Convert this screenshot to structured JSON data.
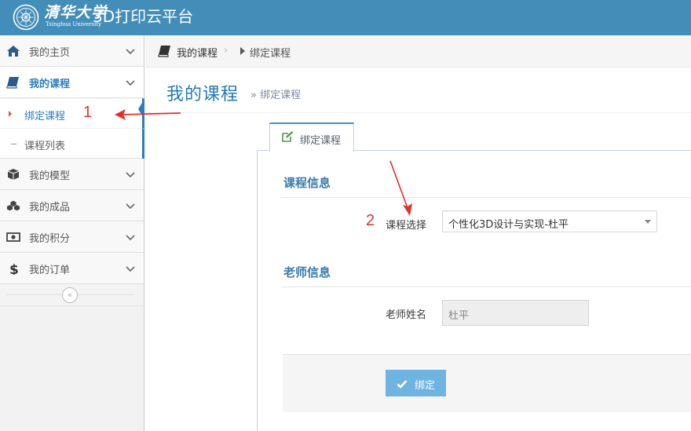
{
  "header": {
    "logo_text": "清华大学",
    "logo_subtext": "Tsinghua University",
    "app_title": "3D打印云平台",
    "bg_color": "#438eb9"
  },
  "sidebar": {
    "items": [
      {
        "label": "我的主页",
        "icon": "home-icon"
      },
      {
        "label": "我的课程",
        "icon": "book-icon",
        "open": true,
        "children": [
          {
            "label": "绑定课程",
            "active": true
          },
          {
            "label": "课程列表"
          }
        ]
      },
      {
        "label": "我的模型",
        "icon": "cube-icon"
      },
      {
        "label": "我的成品",
        "icon": "cubes-icon"
      },
      {
        "label": "我的积分",
        "icon": "money-icon"
      },
      {
        "label": "我的订单",
        "icon": "dollar-icon"
      }
    ],
    "collapse_icon": "double-chevron-left-icon",
    "active_color": "#2b7dbc"
  },
  "breadcrumb": {
    "home": "我的课程",
    "separator": "›",
    "current": "绑定课程"
  },
  "page_header": {
    "title": "我的课程",
    "subtitle": "» 绑定课程"
  },
  "tab": {
    "label": "绑定课程",
    "icon": "edit-icon"
  },
  "course_section": {
    "title": "课程信息",
    "select_label": "课程选择",
    "select_value": "个性化3D设计与实现-杜平"
  },
  "teacher_section": {
    "title": "老师信息",
    "name_label": "老师姓名",
    "name_value": "杜平"
  },
  "actions": {
    "bind_label": "绑定",
    "bind_icon": "check-icon",
    "button_color": "#6fb3e0"
  },
  "annotations": {
    "step1": "1",
    "step2": "2",
    "color": "#e0302c"
  }
}
